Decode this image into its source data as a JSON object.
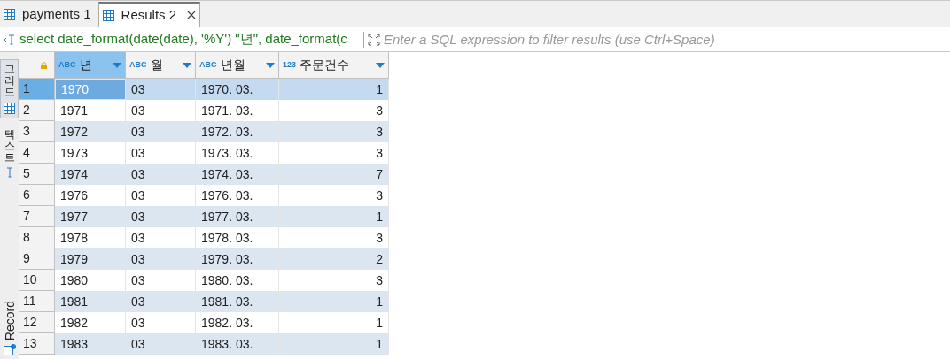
{
  "tabs": [
    {
      "label": "payments 1",
      "selected": false,
      "closable": false
    },
    {
      "label": "Results 2",
      "selected": true,
      "closable": true
    }
  ],
  "filter": {
    "query": "select date_format(date(date), '%Y') \"년\", date_format(c",
    "placeholder": "Enter a SQL expression to filter results (use Ctrl+Space)"
  },
  "side_tabs": [
    {
      "label": "그리드",
      "kind": "grid",
      "selected": true
    },
    {
      "label": "텍스트",
      "kind": "text",
      "selected": false
    },
    {
      "label": "Record",
      "kind": "record",
      "selected": false
    }
  ],
  "columns": [
    {
      "type": "ABC",
      "name": "년",
      "kind": "text",
      "selected": true
    },
    {
      "type": "ABC",
      "name": "월",
      "kind": "text",
      "selected": false
    },
    {
      "type": "ABC",
      "name": "년월",
      "kind": "text",
      "selected": false
    },
    {
      "type": "123",
      "name": "주문건수",
      "kind": "number",
      "selected": false
    }
  ],
  "rows": [
    {
      "number": "1",
      "selected": true,
      "cells": [
        "1970",
        "03",
        "1970. 03.",
        "1"
      ]
    },
    {
      "number": "2",
      "selected": false,
      "cells": [
        "1971",
        "03",
        "1971. 03.",
        "3"
      ]
    },
    {
      "number": "3",
      "selected": false,
      "cells": [
        "1972",
        "03",
        "1972. 03.",
        "3"
      ]
    },
    {
      "number": "4",
      "selected": false,
      "cells": [
        "1973",
        "03",
        "1973. 03.",
        "3"
      ]
    },
    {
      "number": "5",
      "selected": false,
      "cells": [
        "1974",
        "03",
        "1974. 03.",
        "7"
      ]
    },
    {
      "number": "6",
      "selected": false,
      "cells": [
        "1976",
        "03",
        "1976. 03.",
        "3"
      ]
    },
    {
      "number": "7",
      "selected": false,
      "cells": [
        "1977",
        "03",
        "1977. 03.",
        "1"
      ]
    },
    {
      "number": "8",
      "selected": false,
      "cells": [
        "1978",
        "03",
        "1978. 03.",
        "3"
      ]
    },
    {
      "number": "9",
      "selected": false,
      "cells": [
        "1979",
        "03",
        "1979. 03.",
        "2"
      ]
    },
    {
      "number": "10",
      "selected": false,
      "cells": [
        "1980",
        "03",
        "1980. 03.",
        "3"
      ]
    },
    {
      "number": "11",
      "selected": false,
      "cells": [
        "1981",
        "03",
        "1981. 03.",
        "1"
      ]
    },
    {
      "number": "12",
      "selected": false,
      "cells": [
        "1982",
        "03",
        "1982. 03.",
        "1"
      ]
    },
    {
      "number": "13",
      "selected": false,
      "cells": [
        "1983",
        "03",
        "1983. 03.",
        "1"
      ]
    }
  ]
}
